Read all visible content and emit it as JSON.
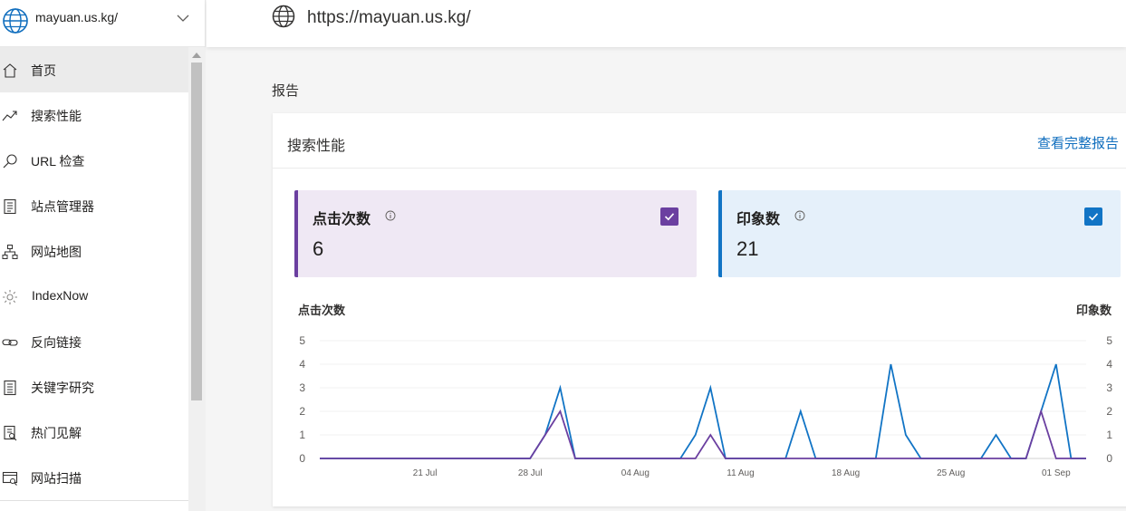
{
  "site_picker": {
    "name": "mayuan.us.kg/"
  },
  "nav": {
    "items": [
      {
        "label": "首页",
        "icon": "home-icon",
        "active": true
      },
      {
        "label": "搜索性能",
        "icon": "trend-icon",
        "active": false
      },
      {
        "label": "URL 检查",
        "icon": "search-icon",
        "active": false
      },
      {
        "label": "站点管理器",
        "icon": "document-icon",
        "active": false
      },
      {
        "label": "网站地图",
        "icon": "sitemap-icon",
        "active": false
      },
      {
        "label": "IndexNow",
        "icon": "gear-icon",
        "active": false
      },
      {
        "label": "反向链接",
        "icon": "link-icon",
        "active": false
      },
      {
        "label": "关键字研究",
        "icon": "document-icon",
        "active": false
      },
      {
        "label": "热门见解",
        "icon": "insight-icon",
        "active": false
      },
      {
        "label": "网站扫描",
        "icon": "scan-icon",
        "active": false
      }
    ]
  },
  "topbar": {
    "url": "https://mayuan.us.kg/"
  },
  "section_title": "报告",
  "card": {
    "title": "搜索性能",
    "link": "查看完整报告",
    "metrics": {
      "clicks": {
        "label": "点击次数",
        "value": "6",
        "color": "#6b3fa0",
        "checked": true
      },
      "impressions": {
        "label": "印象数",
        "value": "21",
        "color": "#1174c5",
        "checked": true
      }
    },
    "axis_left_title": "点击次数",
    "axis_right_title": "印象数"
  },
  "chart_data": {
    "type": "line",
    "x": [
      "07-14",
      "07-15",
      "07-16",
      "07-17",
      "07-18",
      "07-19",
      "07-20",
      "07-21",
      "07-22",
      "07-23",
      "07-24",
      "07-25",
      "07-26",
      "07-27",
      "07-28",
      "07-29",
      "07-30",
      "07-31",
      "08-01",
      "08-02",
      "08-03",
      "08-04",
      "08-05",
      "08-06",
      "08-07",
      "08-08",
      "08-09",
      "08-10",
      "08-11",
      "08-12",
      "08-13",
      "08-14",
      "08-15",
      "08-16",
      "08-17",
      "08-18",
      "08-19",
      "08-20",
      "08-21",
      "08-22",
      "08-23",
      "08-24",
      "08-25",
      "08-26",
      "08-27",
      "08-28",
      "08-29",
      "08-30",
      "08-31",
      "09-01",
      "09-02",
      "09-03"
    ],
    "x_tick_labels": [
      {
        "x": "07-21",
        "label": "21 Jul"
      },
      {
        "x": "07-28",
        "label": "28 Jul"
      },
      {
        "x": "08-04",
        "label": "04 Aug"
      },
      {
        "x": "08-11",
        "label": "11 Aug"
      },
      {
        "x": "08-18",
        "label": "18 Aug"
      },
      {
        "x": "08-25",
        "label": "25 Aug"
      },
      {
        "x": "09-01",
        "label": "01 Sep"
      }
    ],
    "series": [
      {
        "name": "印象数",
        "color": "#1174c5",
        "axis": "right",
        "values": [
          0,
          0,
          0,
          0,
          0,
          0,
          0,
          0,
          0,
          0,
          0,
          0,
          0,
          0,
          0,
          1,
          3,
          0,
          0,
          0,
          0,
          0,
          0,
          0,
          0,
          1,
          3,
          0,
          0,
          0,
          0,
          0,
          2,
          0,
          0,
          0,
          0,
          0,
          4,
          1,
          0,
          0,
          0,
          0,
          0,
          1,
          0,
          0,
          2,
          4,
          0,
          0
        ]
      },
      {
        "name": "点击次数",
        "color": "#6b3fa0",
        "axis": "left",
        "values": [
          0,
          0,
          0,
          0,
          0,
          0,
          0,
          0,
          0,
          0,
          0,
          0,
          0,
          0,
          0,
          1,
          2,
          0,
          0,
          0,
          0,
          0,
          0,
          0,
          0,
          0,
          1,
          0,
          0,
          0,
          0,
          0,
          0,
          0,
          0,
          0,
          0,
          0,
          0,
          0,
          0,
          0,
          0,
          0,
          0,
          0,
          0,
          0,
          2,
          0,
          0,
          0
        ]
      }
    ],
    "y_ticks": [
      0,
      1,
      2,
      3,
      4,
      5
    ],
    "ylim": [
      0,
      5
    ],
    "grid": true,
    "legend": "none"
  }
}
